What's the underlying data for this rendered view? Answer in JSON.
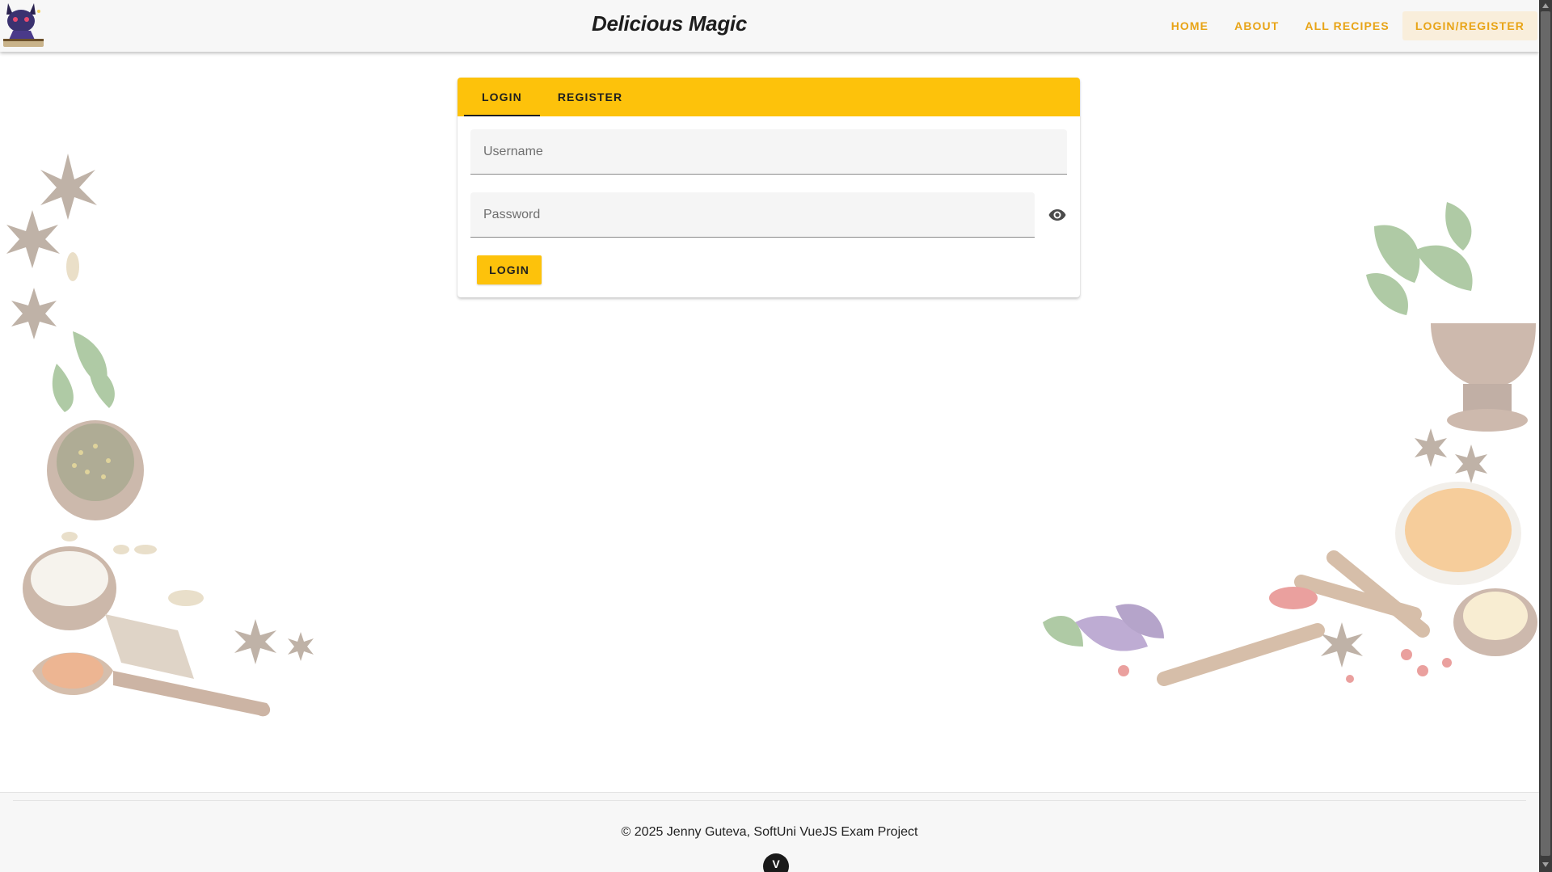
{
  "header": {
    "title": "Delicious Magic",
    "logo_icon": "wizard-cat-book-icon",
    "nav": [
      {
        "label": "HOME"
      },
      {
        "label": "ABOUT"
      },
      {
        "label": "ALL RECIPES"
      },
      {
        "label": "LOGIN/REGISTER",
        "active": true
      }
    ]
  },
  "auth_card": {
    "tabs": [
      {
        "label": "LOGIN",
        "active": true
      },
      {
        "label": "REGISTER"
      }
    ],
    "username": {
      "placeholder": "Username",
      "value": ""
    },
    "password": {
      "placeholder": "Password",
      "value": ""
    },
    "toggle_visibility_icon": "eye-icon",
    "submit_label": "LOGIN"
  },
  "footer": {
    "text": "© 2025 Jenny Guteva, SoftUni VueJS Exam Project",
    "badge": "V"
  },
  "colors": {
    "accent": "#fdc20b",
    "nav_text": "#e8a417",
    "active_nav_bg": "#f9eedb",
    "header_bg": "#f7f7f7"
  }
}
